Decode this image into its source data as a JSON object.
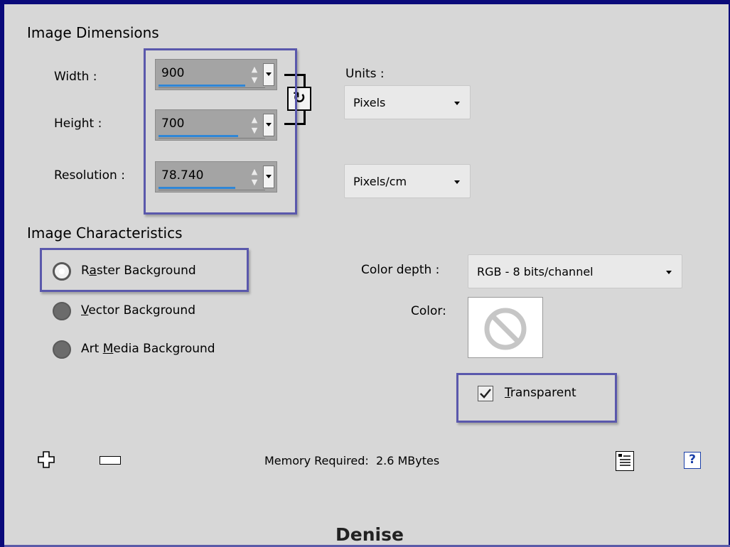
{
  "image_dimensions": {
    "title": "Image Dimensions",
    "width_label": "Width :",
    "width_value": "900",
    "height_label": "Height :",
    "height_value": "700",
    "resolution_label": "Resolution :",
    "resolution_value": "78.740",
    "units_label": "Units :",
    "units_value": "Pixels",
    "resolution_units_value": "Pixels/cm"
  },
  "image_characteristics": {
    "title": "Image Characteristics",
    "raster": {
      "pre": "R",
      "accel": "a",
      "post": "ster Background"
    },
    "vector": {
      "accel": "V",
      "post": "ector Background"
    },
    "art_media": {
      "pre": "Art ",
      "accel": "M",
      "post": "edia Background"
    },
    "selected": "Raster Background",
    "color_depth_label": "Color depth :",
    "color_depth_value": "RGB - 8 bits/channel",
    "color_label": "Color:",
    "transparent": {
      "accel": "T",
      "post": "ransparent",
      "checked": true
    }
  },
  "footer": {
    "memory_label": "Memory Required:",
    "memory_value": "2.6 MBytes"
  },
  "watermark": "Denise",
  "colors": {
    "highlight": "#5a58ac",
    "accent": "#2f86d6",
    "panel": "#d7d7d7",
    "frame": "#0a0a7a"
  }
}
